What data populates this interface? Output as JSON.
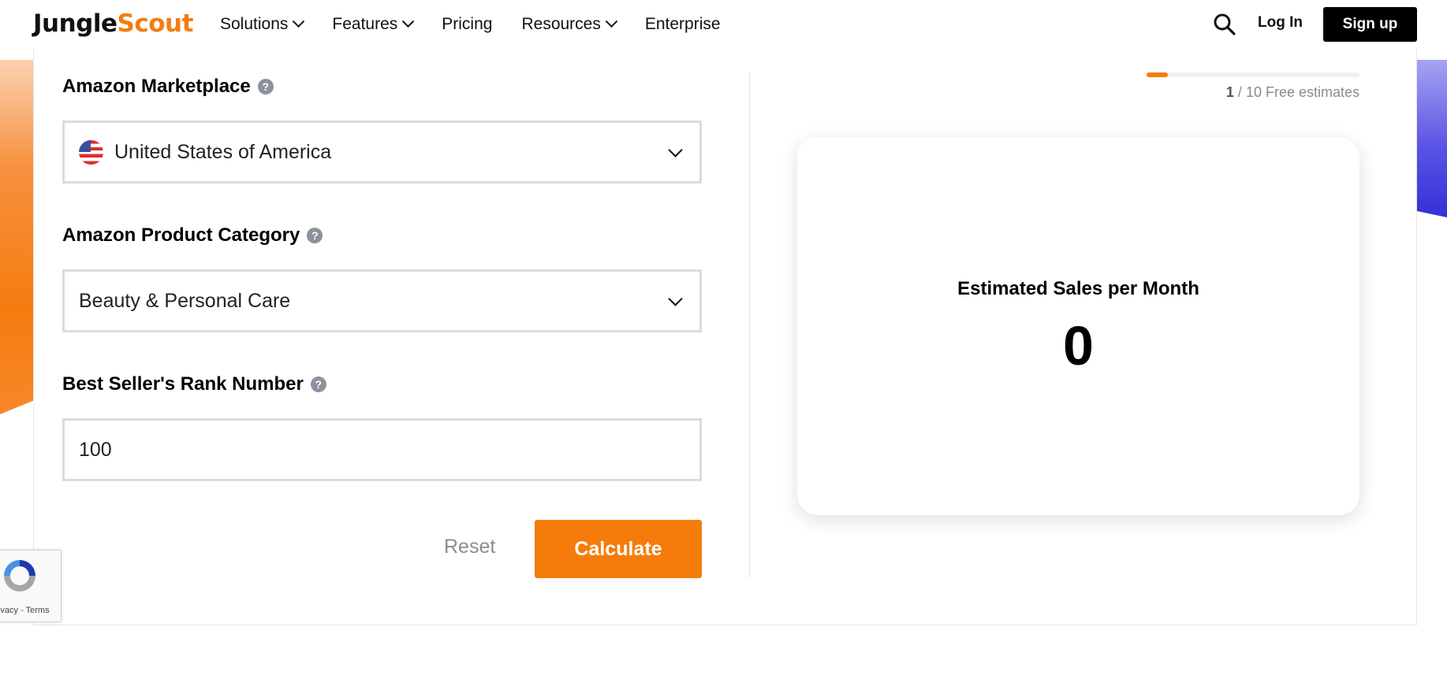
{
  "header": {
    "logo_part1": "Jungle",
    "logo_part2": "Scout",
    "nav": [
      {
        "label": "Solutions",
        "dropdown": true
      },
      {
        "label": "Features",
        "dropdown": true
      },
      {
        "label": "Pricing",
        "dropdown": false
      },
      {
        "label": "Resources",
        "dropdown": true
      },
      {
        "label": "Enterprise",
        "dropdown": false
      }
    ],
    "login_label": "Log In",
    "signup_label": "Sign up",
    "icons": {
      "search": "search-icon"
    }
  },
  "form": {
    "marketplace": {
      "label": "Amazon Marketplace",
      "help": "?",
      "value": "United States of America",
      "flag_icon": "us-flag-icon"
    },
    "category": {
      "label": "Amazon Product Category",
      "help": "?",
      "value": "Beauty & Personal Care"
    },
    "rank": {
      "label": "Best Seller's Rank Number",
      "help": "?",
      "value": "100"
    },
    "reset_label": "Reset",
    "calculate_label": "Calculate"
  },
  "estimates": {
    "used": "1",
    "separator": " / ",
    "total_text": "10 Free estimates",
    "progress_fraction": 0.1
  },
  "result": {
    "label": "Estimated Sales per Month",
    "value": "0"
  },
  "recaptcha": {
    "links": "Privacy - Terms"
  },
  "colors": {
    "accent": "#f57c0a",
    "dark": "#000000",
    "purple": "#3530d8"
  }
}
